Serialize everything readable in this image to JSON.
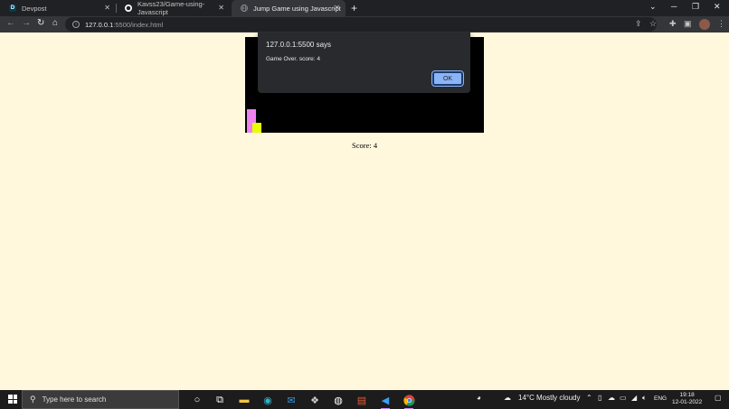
{
  "browser": {
    "tabs": [
      {
        "title": "Devpost",
        "favicon": "D",
        "favicon_color": "#003e54"
      },
      {
        "title": "Kavss23/Game-using-Javascript",
        "favicon": "github-icon",
        "favicon_color": "#ffffff"
      },
      {
        "title": "Jump Game using Javascript",
        "favicon": "globe-icon",
        "favicon_color": "#9aa0a6"
      }
    ],
    "active_tab": 2,
    "url_host": "127.0.0.1",
    "url_path": ":5500/index.html"
  },
  "page": {
    "background": "#fff8dc",
    "score_text": "Score: 4"
  },
  "game": {
    "board_color": "#000000",
    "character_color": "#ee82ee",
    "block_color": "#e5ff00"
  },
  "alert": {
    "title": "127.0.0.1:5500 says",
    "message": "Game Over. score: 4",
    "ok_label": "OK"
  },
  "taskbar": {
    "search_placeholder": "Type here to search",
    "weather_temp": "14°C",
    "weather_desc": "Mostly cloudy",
    "language": "ENG",
    "time": "19:18",
    "date": "12-01-2022",
    "running_apps": [
      "vscode",
      "chrome"
    ]
  }
}
